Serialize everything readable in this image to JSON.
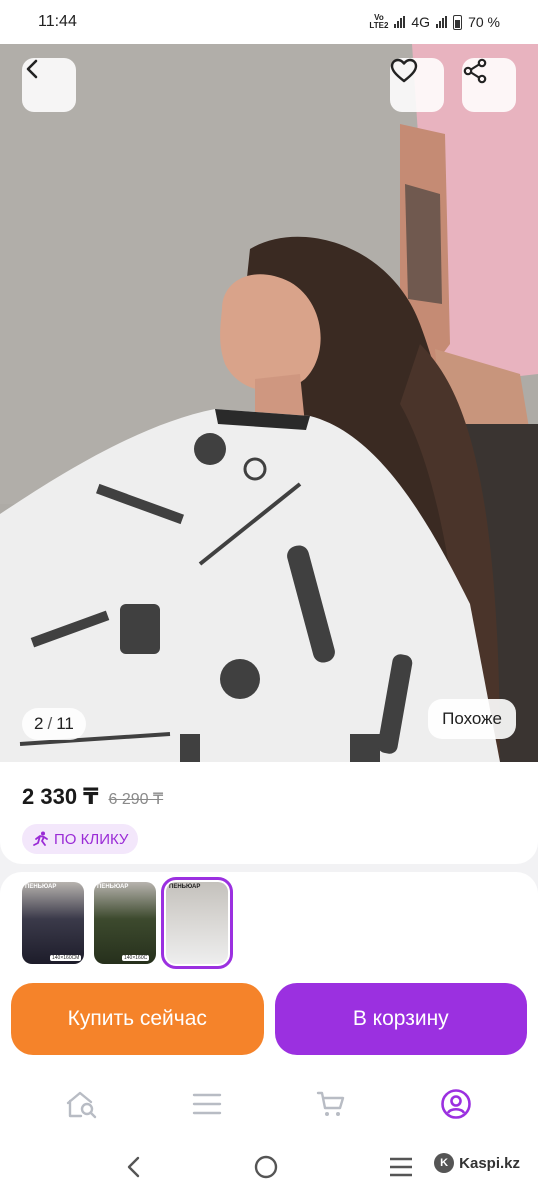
{
  "status_bar": {
    "time": "11:44",
    "volte": "VoLTE2",
    "network": "4G",
    "battery": "70 %"
  },
  "gallery": {
    "current": "2",
    "total": "11",
    "similar_label": "Похоже"
  },
  "product": {
    "price": "2 330 ₸",
    "old_price": "6 290 ₸",
    "promo_label": "ПО КЛИКУ"
  },
  "thumbnails": [
    {
      "title": "ПЕНЬЮАР",
      "size": "140×160СМ",
      "active": false
    },
    {
      "title": "ПЕНЬЮАР",
      "size": "140×160С",
      "active": false
    },
    {
      "title": "ПЕНЬЮАР",
      "size": "",
      "active": true
    }
  ],
  "actions": {
    "buy_now": "Купить сейчас",
    "add_to_cart": "В корзину"
  },
  "tabbar": {
    "items": [
      "home-search-icon",
      "menu-list-icon",
      "cart-icon",
      "profile-icon"
    ],
    "active": "profile-icon"
  },
  "watermark": {
    "text": "Kaspi.kz"
  },
  "colors": {
    "accent_purple": "#9b30e0",
    "buy_orange": "#f5832a",
    "promo_bg": "#f3e7fb"
  }
}
